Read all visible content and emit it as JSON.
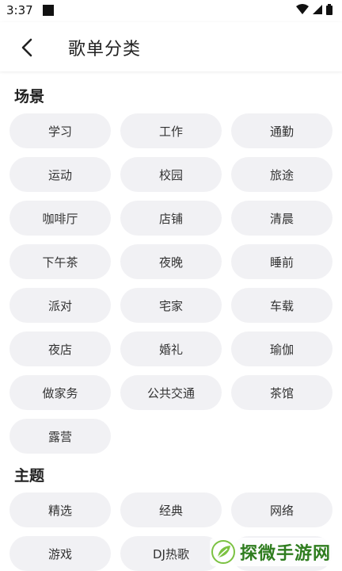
{
  "status_bar": {
    "time": "3:37"
  },
  "app_bar": {
    "title": "歌单分类"
  },
  "sections": [
    {
      "title": "场景",
      "chips": [
        "学习",
        "工作",
        "通勤",
        "运动",
        "校园",
        "旅途",
        "咖啡厅",
        "店铺",
        "清晨",
        "下午茶",
        "夜晚",
        "睡前",
        "派对",
        "宅家",
        "车载",
        "夜店",
        "婚礼",
        "瑜伽",
        "做家务",
        "公共交通",
        "茶馆",
        "露营"
      ]
    },
    {
      "title": "主题",
      "chips": [
        "精选",
        "经典",
        "网络",
        "游戏",
        "DJ热歌",
        ""
      ]
    }
  ],
  "watermark": {
    "text": "探微手游网"
  },
  "colors": {
    "chip_bg": "#f1f1f4",
    "watermark_green": "#2f7d1f"
  }
}
